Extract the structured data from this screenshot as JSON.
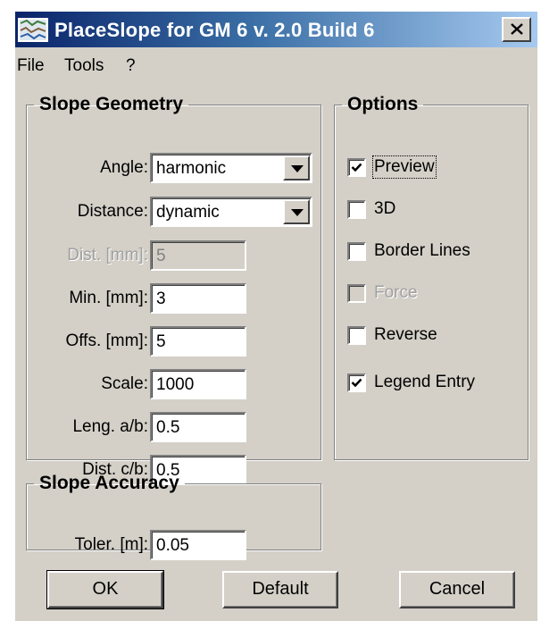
{
  "window": {
    "title": "PlaceSlope for GM 6 v. 2.0 Build 6",
    "close_icon": "close-x-icon"
  },
  "menu": [
    "File",
    "Tools",
    "?"
  ],
  "geometry": {
    "legend": "Slope Geometry",
    "angle": {
      "label": "Angle:",
      "value": "harmonic"
    },
    "distance": {
      "label": "Distance:",
      "value": "dynamic"
    },
    "dist_mm": {
      "label": "Dist. [mm]:",
      "value": "5"
    },
    "min_mm": {
      "label": "Min. [mm]:",
      "value": "3"
    },
    "offs_mm": {
      "label": "Offs. [mm]:",
      "value": "5"
    },
    "scale": {
      "label": "Scale:",
      "value": "1000"
    },
    "leng_ab": {
      "label": "Leng. a/b:",
      "value": "0.5"
    },
    "dist_cb": {
      "label": "Dist. c/b:",
      "value": "0.5"
    }
  },
  "options": {
    "legend": "Options",
    "preview": {
      "label": "Preview",
      "checked": true
    },
    "three_d": {
      "label": "3D",
      "checked": false
    },
    "border_lines": {
      "label": "Border Lines",
      "checked": false
    },
    "force": {
      "label": "Force",
      "checked": false,
      "disabled": true
    },
    "reverse": {
      "label": "Reverse",
      "checked": false
    },
    "legend_entry": {
      "label": "Legend Entry",
      "checked": true
    }
  },
  "accuracy": {
    "legend": "Slope Accuracy",
    "toler": {
      "label": "Toler. [m]:",
      "value": "0.05"
    }
  },
  "buttons": {
    "ok": "OK",
    "default": "Default",
    "cancel": "Cancel"
  }
}
